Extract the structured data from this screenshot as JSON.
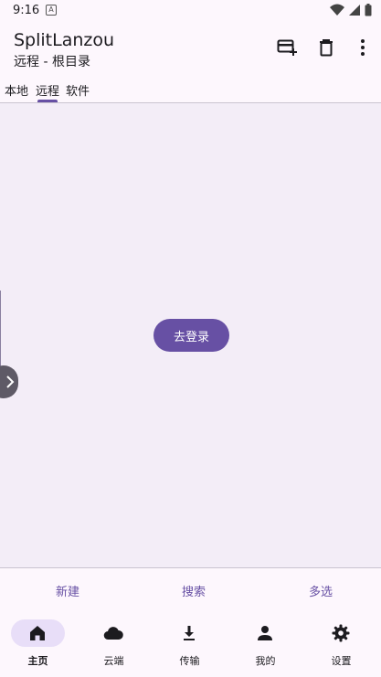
{
  "status_bar": {
    "time": "9:16",
    "notification_letter": "A"
  },
  "app_bar": {
    "title": "SplitLanzou",
    "subtitle": "远程 - 根目录"
  },
  "tabs": [
    {
      "label": "本地",
      "active": false
    },
    {
      "label": "远程",
      "active": true
    },
    {
      "label": "软件",
      "active": false
    }
  ],
  "content": {
    "login_button": "去登录"
  },
  "bottom_actions": {
    "new": "新建",
    "search": "搜索",
    "multi_select": "多选"
  },
  "nav": [
    {
      "label": "主页",
      "icon": "home-icon",
      "active": true
    },
    {
      "label": "云端",
      "icon": "cloud-icon",
      "active": false
    },
    {
      "label": "传输",
      "icon": "download-icon",
      "active": false
    },
    {
      "label": "我的",
      "icon": "person-icon",
      "active": false
    },
    {
      "label": "设置",
      "icon": "gear-icon",
      "active": false
    }
  ],
  "colors": {
    "primary": "#6750a4",
    "surface": "#fdf7fd",
    "content_bg": "#f3edf7",
    "nav_active": "#e8def8"
  }
}
